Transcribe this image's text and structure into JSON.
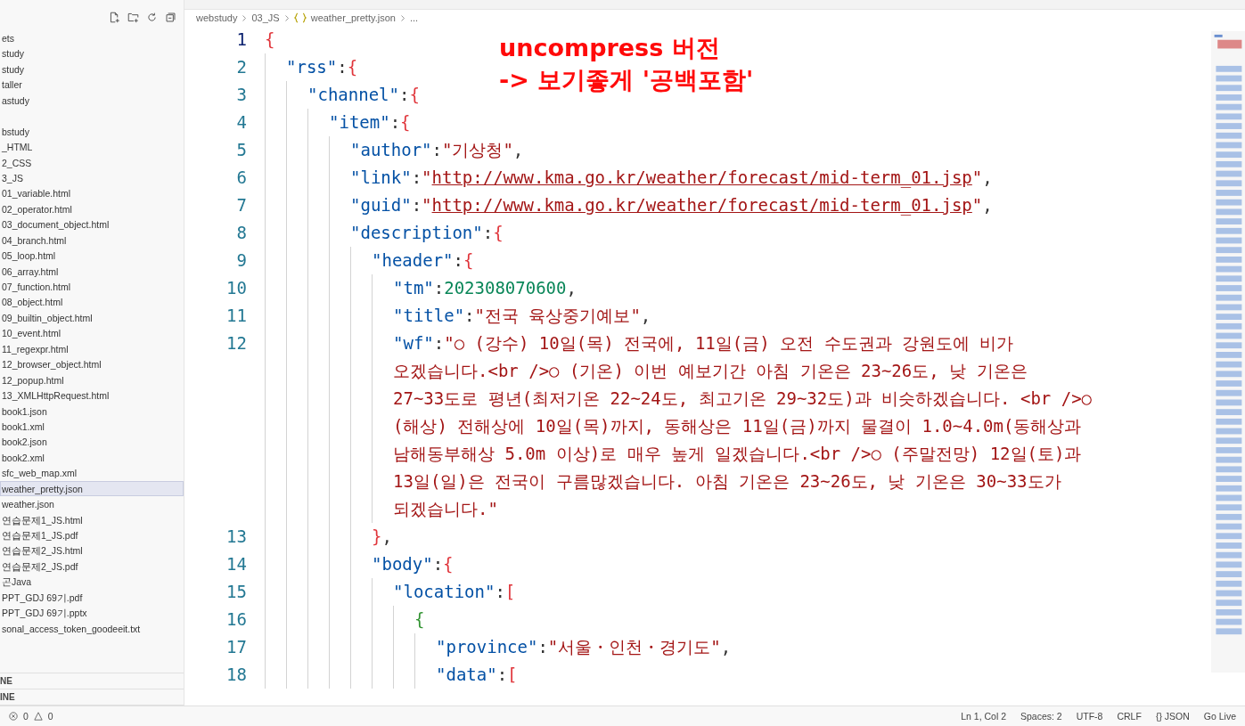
{
  "explorer": {
    "groups": [
      {
        "items": [
          {
            "label": "ets",
            "selected": false
          },
          {
            "label": "study",
            "selected": false
          },
          {
            "label": "study",
            "selected": false
          },
          {
            "label": "taller",
            "selected": false
          },
          {
            "label": "astudy",
            "selected": false
          }
        ]
      },
      {
        "items": [
          {
            "label": "bstudy",
            "selected": false
          },
          {
            "label": "_HTML",
            "selected": false
          },
          {
            "label": "2_CSS",
            "selected": false
          },
          {
            "label": "3_JS",
            "selected": false
          },
          {
            "label": "01_variable.html",
            "selected": false
          },
          {
            "label": "02_operator.html",
            "selected": false
          },
          {
            "label": "03_document_object.html",
            "selected": false
          },
          {
            "label": "04_branch.html",
            "selected": false
          },
          {
            "label": "05_loop.html",
            "selected": false
          },
          {
            "label": "06_array.html",
            "selected": false
          },
          {
            "label": "07_function.html",
            "selected": false
          },
          {
            "label": "08_object.html",
            "selected": false
          },
          {
            "label": "09_builtin_object.html",
            "selected": false
          },
          {
            "label": "10_event.html",
            "selected": false
          },
          {
            "label": "11_regexpr.html",
            "selected": false
          },
          {
            "label": "12_browser_object.html",
            "selected": false
          },
          {
            "label": "12_popup.html",
            "selected": false
          },
          {
            "label": "13_XMLHttpRequest.html",
            "selected": false
          },
          {
            "label": "book1.json",
            "selected": false
          },
          {
            "label": "book1.xml",
            "selected": false
          },
          {
            "label": "book2.json",
            "selected": false
          },
          {
            "label": "book2.xml",
            "selected": false
          },
          {
            "label": "sfc_web_map.xml",
            "selected": false
          },
          {
            "label": "weather_pretty.json",
            "selected": true
          },
          {
            "label": "weather.json",
            "selected": false
          },
          {
            "label": "연습문제1_JS.html",
            "selected": false
          },
          {
            "label": "연습문제1_JS.pdf",
            "selected": false
          },
          {
            "label": "연습문제2_JS.html",
            "selected": false
          },
          {
            "label": "연습문제2_JS.pdf",
            "selected": false
          },
          {
            "label": "곤Java",
            "selected": false
          },
          {
            "label": "PPT_GDJ 69기.pdf",
            "selected": false
          },
          {
            "label": "PPT_GDJ 69기.pptx",
            "selected": false
          },
          {
            "label": "sonal_access_token_goodeeit.txt",
            "selected": false
          }
        ]
      }
    ],
    "sections": [
      "NE",
      "INE"
    ]
  },
  "breadcrumb": [
    "webstudy",
    "03_JS",
    "weather_pretty.json",
    "..."
  ],
  "code_lines": [
    {
      "number": "1",
      "current": true,
      "tokens": [
        {
          "kind": "bracket",
          "text": "{"
        }
      ],
      "children": [
        {
          "number": "2",
          "current": false,
          "tokens": [
            {
              "kind": "key",
              "text": "\"rss\""
            },
            {
              "kind": "punct",
              "text": ":"
            },
            {
              "kind": "bracket",
              "text": "{"
            }
          ],
          "children": [
            {
              "number": "3",
              "current": false,
              "tokens": [
                {
                  "kind": "key",
                  "text": "\"channel\""
                },
                {
                  "kind": "punct",
                  "text": ":"
                },
                {
                  "kind": "bracket",
                  "text": "{"
                }
              ],
              "children": [
                {
                  "number": "4",
                  "current": false,
                  "tokens": [
                    {
                      "kind": "key",
                      "text": "\"item\""
                    },
                    {
                      "kind": "punct",
                      "text": ":"
                    },
                    {
                      "kind": "bracket",
                      "text": "{"
                    }
                  ],
                  "children": [
                    {
                      "number": "5",
                      "current": false,
                      "tokens": [
                        {
                          "kind": "key",
                          "text": "\"author\""
                        },
                        {
                          "kind": "punct",
                          "text": ":"
                        },
                        {
                          "kind": "string",
                          "text": "\"기상청\""
                        },
                        {
                          "kind": "punct",
                          "text": ","
                        }
                      ]
                    },
                    {
                      "number": "6",
                      "current": false,
                      "tokens": [
                        {
                          "kind": "key",
                          "text": "\"link\""
                        },
                        {
                          "kind": "punct",
                          "text": ":"
                        },
                        {
                          "kind": "string",
                          "text": "\""
                        },
                        {
                          "kind": "link",
                          "text": "http://www.kma.go.kr/weather/forecast/mid-term_01.jsp"
                        },
                        {
                          "kind": "string",
                          "text": "\""
                        },
                        {
                          "kind": "punct",
                          "text": ","
                        }
                      ]
                    },
                    {
                      "number": "7",
                      "current": false,
                      "tokens": [
                        {
                          "kind": "key",
                          "text": "\"guid\""
                        },
                        {
                          "kind": "punct",
                          "text": ":"
                        },
                        {
                          "kind": "string",
                          "text": "\""
                        },
                        {
                          "kind": "link",
                          "text": "http://www.kma.go.kr/weather/forecast/mid-term_01.jsp"
                        },
                        {
                          "kind": "string",
                          "text": "\""
                        },
                        {
                          "kind": "punct",
                          "text": ","
                        }
                      ]
                    },
                    {
                      "number": "8",
                      "current": false,
                      "tokens": [
                        {
                          "kind": "key",
                          "text": "\"description\""
                        },
                        {
                          "kind": "punct",
                          "text": ":"
                        },
                        {
                          "kind": "bracket",
                          "text": "{"
                        }
                      ],
                      "children": [
                        {
                          "number": "9",
                          "current": false,
                          "tokens": [
                            {
                              "kind": "key",
                              "text": "\"header\""
                            },
                            {
                              "kind": "punct",
                              "text": ":"
                            },
                            {
                              "kind": "bracket",
                              "text": "{"
                            }
                          ],
                          "children": [
                            {
                              "number": "10",
                              "current": false,
                              "tokens": [
                                {
                                  "kind": "key",
                                  "text": "\"tm\""
                                },
                                {
                                  "kind": "punct",
                                  "text": ":"
                                },
                                {
                                  "kind": "number",
                                  "text": "202308070600"
                                },
                                {
                                  "kind": "punct",
                                  "text": ","
                                }
                              ]
                            },
                            {
                              "number": "11",
                              "current": false,
                              "tokens": [
                                {
                                  "kind": "key",
                                  "text": "\"title\""
                                },
                                {
                                  "kind": "punct",
                                  "text": ":"
                                },
                                {
                                  "kind": "string",
                                  "text": "\"전국 육상중기예보\""
                                },
                                {
                                  "kind": "punct",
                                  "text": ","
                                }
                              ]
                            },
                            {
                              "number": "12",
                              "current": false,
                              "tokens": [
                                {
                                  "kind": "key",
                                  "text": "\"wf\""
                                },
                                {
                                  "kind": "punct",
                                  "text": ":"
                                },
                                {
                                  "kind": "string",
                                  "lines": [
                                    "\"○ (강수) 10일(목) 전국에, 11일(금) 오전 수도권과 강원도에 비가",
                                    "오겠습니다.<br />○ (기온) 이번 예보기간 아침 기온은 23~26도, 낮 기온은",
                                    "27~33도로 평년(최저기온 22~24도, 최고기온 29~32도)과 비슷하겠습니다. <br />○",
                                    "(해상) 전해상에 10일(목)까지, 동해상은 11일(금)까지 물결이 1.0~4.0m(동해상과",
                                    "남해동부해상 5.0m 이상)로 매우 높게 일겠습니다.<br />○ (주말전망) 12일(토)과",
                                    "13일(일)은 전국이 구름많겠습니다. 아침 기온은 23~26도, 낮 기온은 30~33도가",
                                    "되겠습니다.\""
                                  ]
                                }
                              ]
                            }
                          ]
                        },
                        {
                          "number": "13",
                          "current": false,
                          "tokens": [
                            {
                              "kind": "bracket",
                              "text": "}"
                            },
                            {
                              "kind": "punct",
                              "text": ","
                            }
                          ]
                        },
                        {
                          "number": "14",
                          "current": false,
                          "tokens": [
                            {
                              "kind": "key",
                              "text": "\"body\""
                            },
                            {
                              "kind": "punct",
                              "text": ":"
                            },
                            {
                              "kind": "bracket",
                              "text": "{"
                            }
                          ],
                          "children": [
                            {
                              "number": "15",
                              "current": false,
                              "tokens": [
                                {
                                  "kind": "key",
                                  "text": "\"location\""
                                },
                                {
                                  "kind": "punct",
                                  "text": ":"
                                },
                                {
                                  "kind": "bracket",
                                  "text": "["
                                }
                              ],
                              "children": [
                                {
                                  "number": "16",
                                  "current": false,
                                  "tokens": [
                                    {
                                      "kind": "bracket2",
                                      "text": "{"
                                    }
                                  ],
                                  "children": [
                                    {
                                      "number": "17",
                                      "current": false,
                                      "tokens": [
                                        {
                                          "kind": "key",
                                          "text": "\"province\""
                                        },
                                        {
                                          "kind": "punct",
                                          "text": ":"
                                        },
                                        {
                                          "kind": "string",
                                          "text": "\"서울・인천・경기도\""
                                        },
                                        {
                                          "kind": "punct",
                                          "text": ","
                                        }
                                      ]
                                    },
                                    {
                                      "number": "18",
                                      "current": false,
                                      "tokens": [
                                        {
                                          "kind": "key",
                                          "text": "\"data\""
                                        },
                                        {
                                          "kind": "punct",
                                          "text": ":"
                                        },
                                        {
                                          "kind": "bracket",
                                          "text": "["
                                        }
                                      ]
                                    }
                                  ]
                                }
                              ]
                            }
                          ]
                        }
                      ]
                    }
                  ]
                }
              ]
            }
          ]
        }
      ]
    }
  ],
  "annotation": {
    "lines": [
      "uncompress 버전",
      "-> 보기좋게 '공백포함'"
    ]
  },
  "status_bar": {
    "errors": "0",
    "warnings": "0",
    "items": [
      "Ln 1, Col 2",
      "Spaces: 2",
      "UTF-8",
      "CRLF",
      "{} JSON",
      "Go Live"
    ]
  }
}
